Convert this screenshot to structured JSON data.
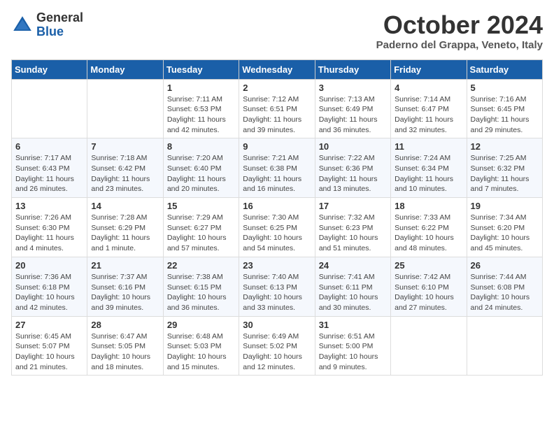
{
  "logo": {
    "general": "General",
    "blue": "Blue"
  },
  "title": "October 2024",
  "location": "Paderno del Grappa, Veneto, Italy",
  "days_of_week": [
    "Sunday",
    "Monday",
    "Tuesday",
    "Wednesday",
    "Thursday",
    "Friday",
    "Saturday"
  ],
  "weeks": [
    [
      {
        "day": "",
        "info": ""
      },
      {
        "day": "",
        "info": ""
      },
      {
        "day": "1",
        "info": "Sunrise: 7:11 AM\nSunset: 6:53 PM\nDaylight: 11 hours and 42 minutes."
      },
      {
        "day": "2",
        "info": "Sunrise: 7:12 AM\nSunset: 6:51 PM\nDaylight: 11 hours and 39 minutes."
      },
      {
        "day": "3",
        "info": "Sunrise: 7:13 AM\nSunset: 6:49 PM\nDaylight: 11 hours and 36 minutes."
      },
      {
        "day": "4",
        "info": "Sunrise: 7:14 AM\nSunset: 6:47 PM\nDaylight: 11 hours and 32 minutes."
      },
      {
        "day": "5",
        "info": "Sunrise: 7:16 AM\nSunset: 6:45 PM\nDaylight: 11 hours and 29 minutes."
      }
    ],
    [
      {
        "day": "6",
        "info": "Sunrise: 7:17 AM\nSunset: 6:43 PM\nDaylight: 11 hours and 26 minutes."
      },
      {
        "day": "7",
        "info": "Sunrise: 7:18 AM\nSunset: 6:42 PM\nDaylight: 11 hours and 23 minutes."
      },
      {
        "day": "8",
        "info": "Sunrise: 7:20 AM\nSunset: 6:40 PM\nDaylight: 11 hours and 20 minutes."
      },
      {
        "day": "9",
        "info": "Sunrise: 7:21 AM\nSunset: 6:38 PM\nDaylight: 11 hours and 16 minutes."
      },
      {
        "day": "10",
        "info": "Sunrise: 7:22 AM\nSunset: 6:36 PM\nDaylight: 11 hours and 13 minutes."
      },
      {
        "day": "11",
        "info": "Sunrise: 7:24 AM\nSunset: 6:34 PM\nDaylight: 11 hours and 10 minutes."
      },
      {
        "day": "12",
        "info": "Sunrise: 7:25 AM\nSunset: 6:32 PM\nDaylight: 11 hours and 7 minutes."
      }
    ],
    [
      {
        "day": "13",
        "info": "Sunrise: 7:26 AM\nSunset: 6:30 PM\nDaylight: 11 hours and 4 minutes."
      },
      {
        "day": "14",
        "info": "Sunrise: 7:28 AM\nSunset: 6:29 PM\nDaylight: 11 hours and 1 minute."
      },
      {
        "day": "15",
        "info": "Sunrise: 7:29 AM\nSunset: 6:27 PM\nDaylight: 10 hours and 57 minutes."
      },
      {
        "day": "16",
        "info": "Sunrise: 7:30 AM\nSunset: 6:25 PM\nDaylight: 10 hours and 54 minutes."
      },
      {
        "day": "17",
        "info": "Sunrise: 7:32 AM\nSunset: 6:23 PM\nDaylight: 10 hours and 51 minutes."
      },
      {
        "day": "18",
        "info": "Sunrise: 7:33 AM\nSunset: 6:22 PM\nDaylight: 10 hours and 48 minutes."
      },
      {
        "day": "19",
        "info": "Sunrise: 7:34 AM\nSunset: 6:20 PM\nDaylight: 10 hours and 45 minutes."
      }
    ],
    [
      {
        "day": "20",
        "info": "Sunrise: 7:36 AM\nSunset: 6:18 PM\nDaylight: 10 hours and 42 minutes."
      },
      {
        "day": "21",
        "info": "Sunrise: 7:37 AM\nSunset: 6:16 PM\nDaylight: 10 hours and 39 minutes."
      },
      {
        "day": "22",
        "info": "Sunrise: 7:38 AM\nSunset: 6:15 PM\nDaylight: 10 hours and 36 minutes."
      },
      {
        "day": "23",
        "info": "Sunrise: 7:40 AM\nSunset: 6:13 PM\nDaylight: 10 hours and 33 minutes."
      },
      {
        "day": "24",
        "info": "Sunrise: 7:41 AM\nSunset: 6:11 PM\nDaylight: 10 hours and 30 minutes."
      },
      {
        "day": "25",
        "info": "Sunrise: 7:42 AM\nSunset: 6:10 PM\nDaylight: 10 hours and 27 minutes."
      },
      {
        "day": "26",
        "info": "Sunrise: 7:44 AM\nSunset: 6:08 PM\nDaylight: 10 hours and 24 minutes."
      }
    ],
    [
      {
        "day": "27",
        "info": "Sunrise: 6:45 AM\nSunset: 5:07 PM\nDaylight: 10 hours and 21 minutes."
      },
      {
        "day": "28",
        "info": "Sunrise: 6:47 AM\nSunset: 5:05 PM\nDaylight: 10 hours and 18 minutes."
      },
      {
        "day": "29",
        "info": "Sunrise: 6:48 AM\nSunset: 5:03 PM\nDaylight: 10 hours and 15 minutes."
      },
      {
        "day": "30",
        "info": "Sunrise: 6:49 AM\nSunset: 5:02 PM\nDaylight: 10 hours and 12 minutes."
      },
      {
        "day": "31",
        "info": "Sunrise: 6:51 AM\nSunset: 5:00 PM\nDaylight: 10 hours and 9 minutes."
      },
      {
        "day": "",
        "info": ""
      },
      {
        "day": "",
        "info": ""
      }
    ]
  ]
}
